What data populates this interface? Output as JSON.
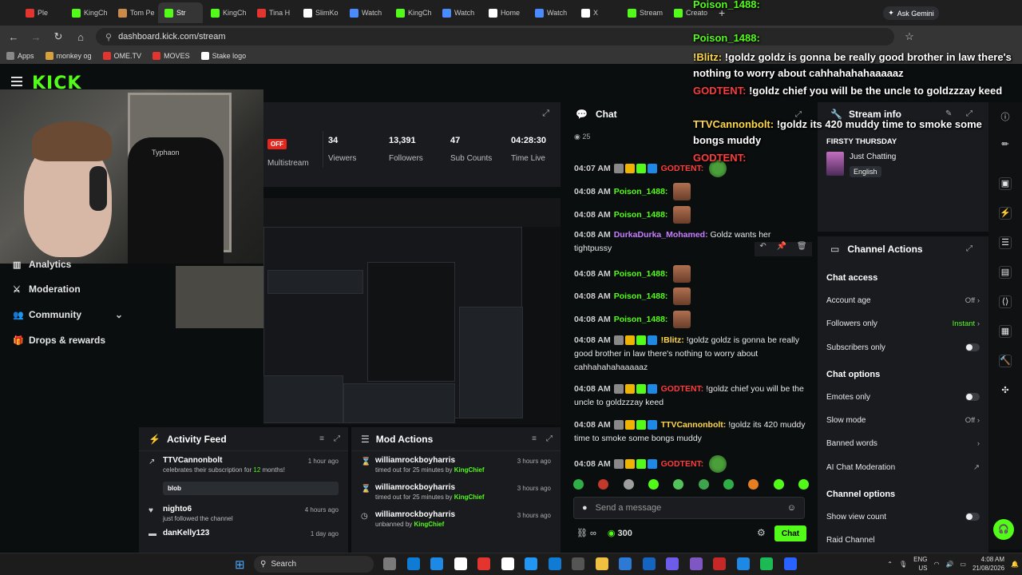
{
  "browser": {
    "tabs": [
      {
        "label": "Ple",
        "color": "#e3342f"
      },
      {
        "label": "KingCh",
        "color": "#53fc18"
      },
      {
        "label": "Tom Pe",
        "color": "#c98a4b"
      },
      {
        "label": "Str",
        "color": "#53fc18",
        "active": true
      },
      {
        "label": "KingCh",
        "color": "#53fc18"
      },
      {
        "label": "Tina H",
        "color": "#e3342f"
      },
      {
        "label": "SlimKo",
        "color": "#ffffff"
      },
      {
        "label": "Watch",
        "color": "#4a8bff"
      },
      {
        "label": "KingCh",
        "color": "#53fc18"
      },
      {
        "label": "Watch",
        "color": "#4a8bff"
      },
      {
        "label": "Home",
        "color": "#ffffff"
      },
      {
        "label": "Watch",
        "color": "#4a8bff"
      },
      {
        "label": "X",
        "color": "#ffffff"
      },
      {
        "label": "Stream",
        "color": "#53fc18"
      },
      {
        "label": "Creato",
        "color": "#53fc18"
      }
    ],
    "url": "dashboard.kick.com/stream",
    "ask_gemini": "Ask Gemini",
    "bookmarks": [
      {
        "label": "Apps",
        "color": "#888888"
      },
      {
        "label": "monkey og",
        "color": "#d8a13a"
      },
      {
        "label": "OME.TV",
        "color": "#e3342f"
      },
      {
        "label": "MOVES",
        "color": "#e3342f"
      },
      {
        "label": "Stake logo",
        "color": "#ffffff"
      }
    ]
  },
  "kick": {
    "logo": "KICK"
  },
  "webcam": {
    "logo_text": "Typhaon"
  },
  "sidebar": {
    "items": [
      {
        "label": "Analytics",
        "icon": "chart-icon"
      },
      {
        "label": "Moderation",
        "icon": "sword-icon"
      },
      {
        "label": "Community",
        "icon": "people-icon"
      },
      {
        "label": "Drops & rewards",
        "icon": "gift-icon"
      }
    ]
  },
  "stats": {
    "status": "OFF",
    "status_label": "Multistream",
    "viewers": "34",
    "viewers_label": "Viewers",
    "followers": "13,391",
    "followers_label": "Followers",
    "subs": "47",
    "subs_label": "Sub Counts",
    "time": "04:28:30",
    "time_label": "Time Live"
  },
  "activity": {
    "title": "Activity Feed",
    "items": [
      {
        "who": "TTVCannonbolt",
        "what_pre": "celebrates their subscription for ",
        "what_hl": "12",
        "what_post": " months!",
        "when": "1 hour ago",
        "note": "blob"
      },
      {
        "who": "nighto6",
        "what_pre": "just followed the channel",
        "what_hl": "",
        "what_post": "",
        "when": "4 hours ago"
      },
      {
        "who": "danKelly123",
        "what_pre": "",
        "what_hl": "",
        "what_post": "",
        "when": "1 day ago"
      }
    ]
  },
  "modactions": {
    "title": "Mod Actions",
    "items": [
      {
        "who": "williamrockboyharris",
        "what": "timed out for 25 minutes by ",
        "by": "KingChief",
        "when": "3 hours ago"
      },
      {
        "who": "williamrockboyharris",
        "what": "timed out for 25 minutes by ",
        "by": "KingChief",
        "when": "3 hours ago"
      },
      {
        "who": "williamrockboyharris",
        "what": "unbanned by ",
        "by": "KingChief",
        "when": "3 hours ago"
      }
    ]
  },
  "chat": {
    "title": "Chat",
    "viewer_count": "25",
    "messages": [
      {
        "time": "04:07 AM",
        "user": "GODTENT:",
        "color": "#ff3b3b",
        "text": "",
        "emote": "frog"
      },
      {
        "time": "04:08 AM",
        "user": "Poison_1488:",
        "color": "#53fc18",
        "text": "",
        "emote": "face"
      },
      {
        "time": "04:08 AM",
        "user": "Poison_1488:",
        "color": "#53fc18",
        "text": "",
        "emote": "face"
      },
      {
        "time": "04:08 AM",
        "user": "DurkaDurka_Mohamed:",
        "color": "#c77dff",
        "text": "Goldz wants her tightpussy"
      },
      {
        "time": "04:08 AM",
        "user": "Poison_1488:",
        "color": "#53fc18",
        "text": "",
        "emote": "face"
      },
      {
        "time": "04:08 AM",
        "user": "Poison_1488:",
        "color": "#53fc18",
        "text": "",
        "emote": "face"
      },
      {
        "time": "04:08 AM",
        "user": "Poison_1488:",
        "color": "#53fc18",
        "text": "",
        "emote": "face"
      },
      {
        "time": "04:08 AM",
        "user": "!Blitz:",
        "color": "#ffd84a",
        "text": "!goldz goldz is gonna be really good brother in law there's nothing to worry about cahhahahahaaaaaz"
      },
      {
        "time": "04:08 AM",
        "user": "GODTENT:",
        "color": "#ff3b3b",
        "text": "!goldz chief you will be the uncle to goldzzzay keed"
      },
      {
        "time": "04:08 AM",
        "user": "TTVCannonbolt:",
        "color": "#ffd84a",
        "text": "!goldz its 420 muddy time to smoke some bongs muddy"
      },
      {
        "time": "04:08 AM",
        "user": "GODTENT:",
        "color": "#ff3b3b",
        "text": "",
        "emote": "frog"
      }
    ],
    "placeholder": "Send a message",
    "points": "300",
    "send_label": "Chat"
  },
  "overlay": {
    "lines": [
      {
        "user": "Poison_1488:",
        "color": "#53fc18",
        "text": ""
      },
      {
        "user": "Poison_1488:",
        "color": "#53fc18",
        "text": ""
      },
      {
        "user": "!Blitz:",
        "color": "#ffd84a",
        "text": "!goldz goldz is gonna be really good brother in law there's nothing to worry about cahhahahahaaaaaz"
      },
      {
        "user": "GODTENT:",
        "color": "#ff3b3b",
        "text": "!goldz chief you will be the uncle to goldzzzay keed"
      },
      {
        "user": "TTVCannonbolt:",
        "color": "#ffd84a",
        "text": "!goldz its 420 muddy time to smoke some bongs muddy"
      },
      {
        "user": "GODTENT:",
        "color": "#ff3b3b",
        "text": ""
      }
    ]
  },
  "stream_info": {
    "title": "Stream info",
    "stream_title": "FIRSTY THURSDAY",
    "category": "Just Chatting",
    "language": "English"
  },
  "channel_actions": {
    "title": "Channel Actions",
    "chat_access": "Chat access",
    "account_age": "Account age",
    "account_age_val": "Off",
    "followers_only": "Followers only",
    "followers_only_val": "Instant",
    "subscribers_only": "Subscribers only",
    "chat_options": "Chat options",
    "emotes_only": "Emotes only",
    "slow_mode": "Slow mode",
    "slow_mode_val": "Off",
    "banned_words": "Banned words",
    "ai_mod": "AI Chat Moderation",
    "channel_options": "Channel options",
    "show_viewers": "Show view count",
    "raid": "Raid Channel"
  },
  "taskbar": {
    "search": "Search",
    "lang": "ENG",
    "region": "US",
    "time": "4:08 AM",
    "date": "21/08/2026"
  }
}
